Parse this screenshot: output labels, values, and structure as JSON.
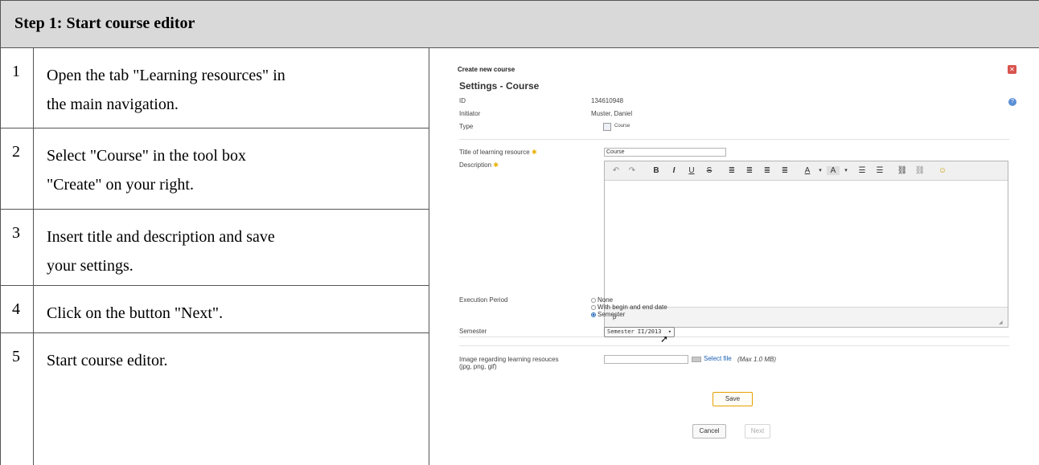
{
  "header": {
    "title": "Step 1: Start course editor"
  },
  "steps": [
    {
      "num": "1",
      "line1": "Open the tab \"Learning resources\" in",
      "line2": "the main navigation."
    },
    {
      "num": "2",
      "line1": "Select \"Course\" in the tool box",
      "line2": "\"Create\" on your right."
    },
    {
      "num": "3",
      "line1": "Insert title and description and save",
      "line2": "your settings."
    },
    {
      "num": "4",
      "line1": "Click on the button \"Next\".",
      "line2": ""
    },
    {
      "num": "5",
      "line1": "Start course editor.",
      "line2": ""
    }
  ],
  "dialog": {
    "title": "Create new course",
    "section_title": "Settings - Course",
    "id_label": "ID",
    "id_value": "134610948",
    "initiator_label": "Initiator",
    "initiator_value": "Muster, Daniel",
    "type_label": "Type",
    "type_value": "Course",
    "title_label": "Title of learning resource",
    "title_value": "Course",
    "description_label": "Description",
    "editor_path": "p",
    "toolbar": {
      "undo": "↶",
      "redo": "↷",
      "bold": "B",
      "italic": "I",
      "underline": "U",
      "strike": "S",
      "align_left": "≣",
      "align_center": "≣",
      "align_right": "≣",
      "justify": "≣",
      "text_color": "A",
      "bg_color": "A",
      "bullets": "☰",
      "numbers": "☰",
      "link": "⛓",
      "unlink": "⛓",
      "emoji": "☺"
    },
    "execution_period_label": "Execution Period",
    "period_options": [
      "None",
      "With begin and end date",
      "Semester"
    ],
    "period_selected": "Semester",
    "semester_label": "Semester",
    "semester_value": "Semester II/2013",
    "image_label_line1": "Image regarding learning resouces",
    "image_label_line2": "(jpg, png, gif)",
    "select_file": "Select file",
    "max_size": "(Max 1.0 MB)",
    "save": "Save",
    "cancel": "Cancel",
    "next": "Next",
    "required_marker": "✱",
    "help": "?",
    "close": "✕"
  },
  "colors": {
    "header_bg": "#d9d9d9",
    "border": "#555555",
    "close_red": "#d9534f",
    "link_blue": "#1a5fb4",
    "save_border": "#e8a000"
  }
}
